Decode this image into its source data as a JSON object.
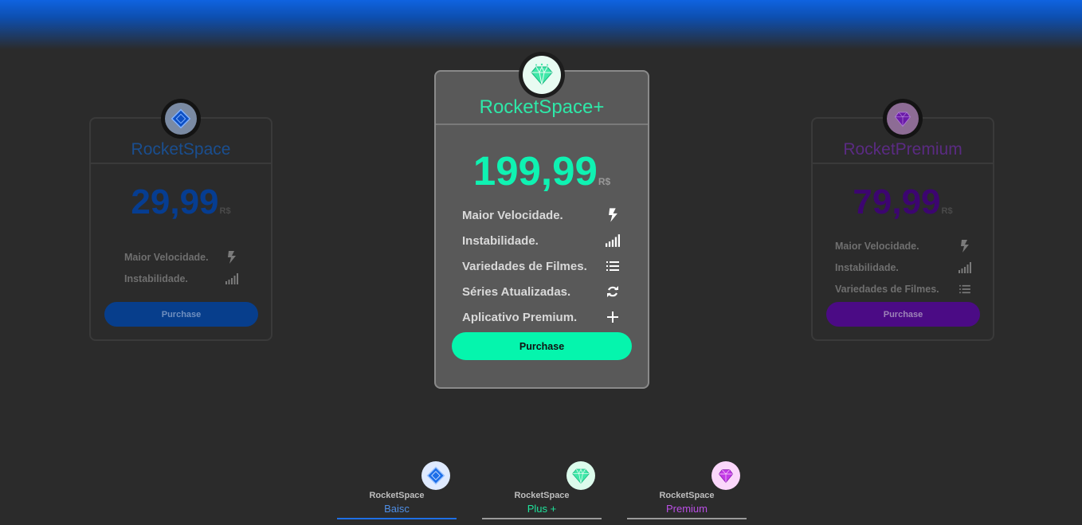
{
  "colors": {
    "accent_basic": "#073e8c",
    "accent_plus": "#05f5ad",
    "accent_premium": "#4b0b85",
    "background": "#2b2b2b"
  },
  "plans": {
    "basic": {
      "name": "RocketSpace",
      "price": "29,99",
      "currency": "R$",
      "badge_icon": "diamond-shape-icon",
      "features": [
        {
          "label": "Maior Velocidade.",
          "icon": "lightning-icon"
        },
        {
          "label": "Instabilidade.",
          "icon": "signal-bars-icon"
        }
      ],
      "button_label": "Purchase"
    },
    "plus": {
      "name": "RocketSpace+",
      "price": "199,99",
      "currency": "R$",
      "badge_icon": "gem-icon",
      "features": [
        {
          "label": "Maior Velocidade.",
          "icon": "lightning-icon"
        },
        {
          "label": "Instabilidade.",
          "icon": "signal-bars-icon"
        },
        {
          "label": "Variedades de Filmes.",
          "icon": "list-icon"
        },
        {
          "label": "Séries Atualizadas.",
          "icon": "sync-icon"
        },
        {
          "label": "Aplicativo Premium.",
          "icon": "plus-icon"
        }
      ],
      "button_label": "Purchase"
    },
    "premium": {
      "name": "RocketPremium",
      "price": "79,99",
      "currency": "R$",
      "badge_icon": "gem-icon",
      "features": [
        {
          "label": "Maior Velocidade.",
          "icon": "lightning-icon"
        },
        {
          "label": "Instabilidade.",
          "icon": "signal-bars-icon"
        },
        {
          "label": "Variedades de Filmes.",
          "icon": "list-icon"
        }
      ],
      "button_label": "Purchase"
    }
  },
  "tabs": [
    {
      "brand": "RocketSpace",
      "name": "Baisc",
      "active": true
    },
    {
      "brand": "RocketSpace",
      "name": "Plus +",
      "active": false
    },
    {
      "brand": "RocketSpace",
      "name": "Premium",
      "active": false
    }
  ]
}
